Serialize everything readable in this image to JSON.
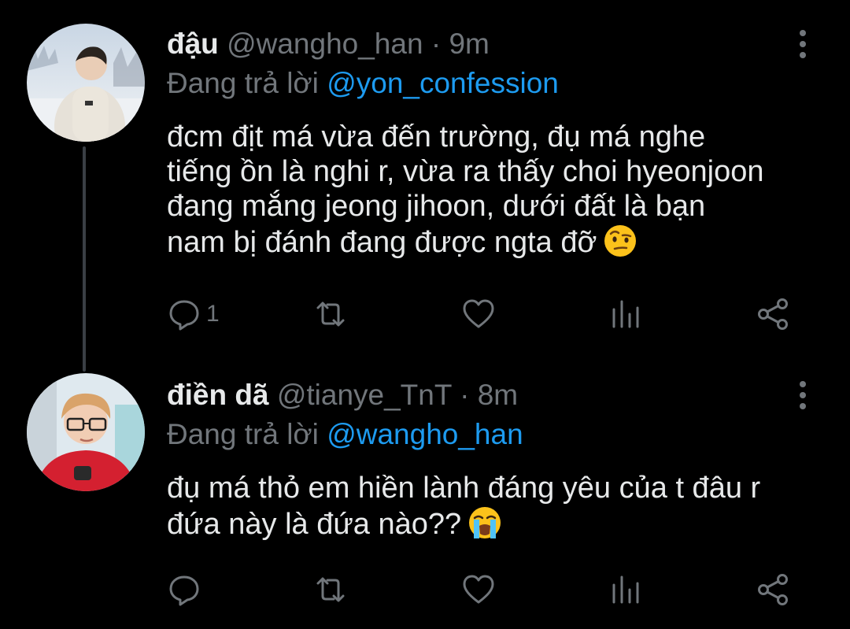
{
  "tweets": [
    {
      "name": "đậu",
      "handle": "@wangho_han",
      "separator": "·",
      "time": "9m",
      "reply_prefix": "Đang trả lời",
      "reply_to": "@yon_confession",
      "lines": [
        "đcm địt má vừa đến trường, đụ má nghe",
        "tiếng ồn là nghi r, vừa ra thấy choi hyeonjoon",
        "đang mắng jeong jihoon, dưới đất là bạn",
        "nam bị đánh đang được ngta đỡ"
      ],
      "emoji": "raised-eyebrow-emoji",
      "reply_count": "1",
      "icons": [
        "reply-icon",
        "retweet-icon",
        "like-icon",
        "analytics-icon",
        "share-icon"
      ]
    },
    {
      "name": "điền dã",
      "handle": "@tianye_TnT",
      "separator": "·",
      "time": "8m",
      "reply_prefix": "Đang trả lời",
      "reply_to": "@wangho_han",
      "lines": [
        "đụ má thỏ em hiền lành đáng yêu của t đâu r",
        "đứa này là đứa nào??"
      ],
      "emoji": "loudly-crying-emoji",
      "reply_count": "",
      "icons": [
        "reply-icon",
        "retweet-icon",
        "like-icon",
        "analytics-icon",
        "share-icon"
      ]
    }
  ],
  "colors": {
    "background": "#000000",
    "text": "#e7e9ea",
    "muted": "#71767b",
    "link": "#1d9bf0",
    "thread_line": "#3a3f45"
  }
}
